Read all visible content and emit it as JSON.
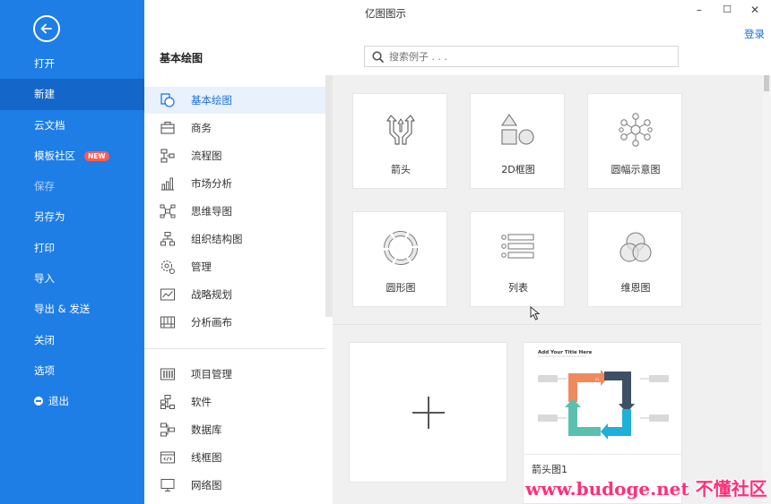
{
  "window": {
    "title": "亿图图示",
    "minimize": "–",
    "maximize": "☐",
    "close": "✕",
    "login": "登录"
  },
  "sidebar": {
    "items": [
      {
        "label": "打开"
      },
      {
        "label": "新建"
      },
      {
        "label": "云文档"
      },
      {
        "label": "模板社区",
        "badge": "NEW"
      },
      {
        "label": "保存"
      },
      {
        "label": "另存为"
      },
      {
        "label": "打印"
      },
      {
        "label": "导入"
      },
      {
        "label": "导出 & 发送"
      },
      {
        "label": "关闭"
      },
      {
        "label": "选项"
      },
      {
        "label": "退出"
      }
    ]
  },
  "header": {
    "section_title": "基本绘图",
    "search_placeholder": "搜索例子 . . ."
  },
  "categories": [
    {
      "label": "基本绘图",
      "icon": "basic-shape-icon"
    },
    {
      "label": "商务",
      "icon": "briefcase-icon"
    },
    {
      "label": "流程图",
      "icon": "flowchart-icon"
    },
    {
      "label": "市场分析",
      "icon": "bar-chart-icon"
    },
    {
      "label": "思维导图",
      "icon": "mindmap-icon"
    },
    {
      "label": "组织结构图",
      "icon": "org-chart-icon"
    },
    {
      "label": "管理",
      "icon": "gear-icon"
    },
    {
      "label": "战略规划",
      "icon": "strategy-icon"
    },
    {
      "label": "分析画布",
      "icon": "canvas-icon"
    },
    {
      "label": "项目管理",
      "icon": "project-icon"
    },
    {
      "label": "软件",
      "icon": "software-icon"
    },
    {
      "label": "数据库",
      "icon": "database-icon"
    },
    {
      "label": "线框图",
      "icon": "wireframe-icon"
    },
    {
      "label": "网络图",
      "icon": "network-icon"
    }
  ],
  "tiles": [
    {
      "label": "箭头",
      "icon": "arrows-icon"
    },
    {
      "label": "2D框图",
      "icon": "shapes-2d-icon"
    },
    {
      "label": "圆幅示意图",
      "icon": "radial-diagram-icon"
    },
    {
      "label": "圆形图",
      "icon": "circular-diagram-icon"
    },
    {
      "label": "列表",
      "icon": "list-icon"
    },
    {
      "label": "维恩图",
      "icon": "venn-icon"
    }
  ],
  "templates": {
    "thumb_title": "Add Your Title Here",
    "card_label": "箭头图1"
  },
  "watermark": "www.budoge.net 不懂社区",
  "colors": {
    "sidebar": "#1e7ee6",
    "sidebar_active": "#1466c9",
    "badge": "#ff5b4f",
    "accent": "#1e6fd9"
  }
}
